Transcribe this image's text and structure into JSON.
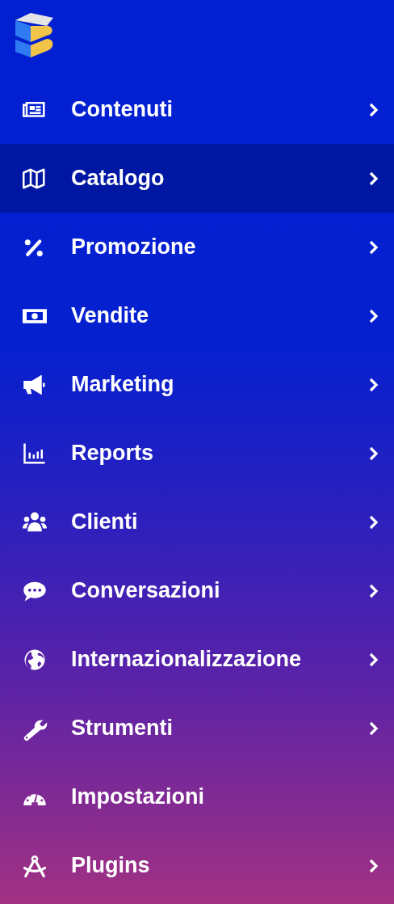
{
  "menu": [
    {
      "label": "Contenuti",
      "selected": false,
      "has_submenu": true
    },
    {
      "label": "Catalogo",
      "selected": true,
      "has_submenu": true
    },
    {
      "label": "Promozione",
      "selected": false,
      "has_submenu": true
    },
    {
      "label": "Vendite",
      "selected": false,
      "has_submenu": true
    },
    {
      "label": "Marketing",
      "selected": false,
      "has_submenu": true
    },
    {
      "label": "Reports",
      "selected": false,
      "has_submenu": true
    },
    {
      "label": "Clienti",
      "selected": false,
      "has_submenu": true
    },
    {
      "label": "Conversazioni",
      "selected": false,
      "has_submenu": true
    },
    {
      "label": "Internazionalizzazione",
      "selected": false,
      "has_submenu": true
    },
    {
      "label": "Strumenti",
      "selected": false,
      "has_submenu": true
    },
    {
      "label": "Impostazioni",
      "selected": false,
      "has_submenu": false
    },
    {
      "label": "Plugins",
      "selected": false,
      "has_submenu": true
    }
  ]
}
